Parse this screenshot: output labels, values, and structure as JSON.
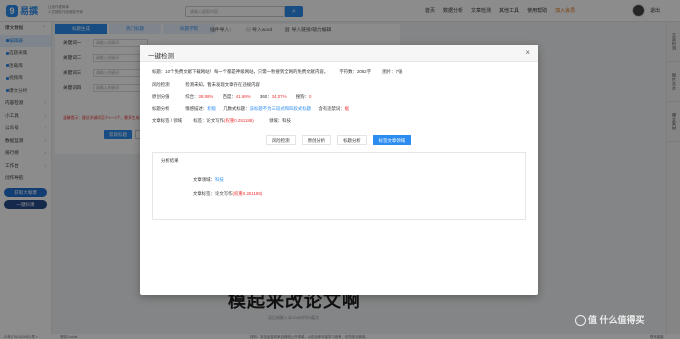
{
  "header": {
    "logo_mark": "9",
    "logo_text": "易撰",
    "slogan_line1": "让创作更简单",
    "slogan_line2": "人员团队作品赋能专家",
    "search_placeholder": "请输入搜索内容",
    "nav": [
      "首页",
      "数据分析",
      "文章检测",
      "其他工具",
      "使用帮助"
    ],
    "vip": "加入会员",
    "logout": "退出"
  },
  "sidebar": {
    "items": [
      {
        "label": "爆文数据",
        "type": "group"
      },
      {
        "label": "编辑器",
        "type": "sub",
        "active": true
      },
      {
        "label": "选题采集",
        "type": "sub"
      },
      {
        "label": "连载库",
        "type": "sub"
      },
      {
        "label": "视频库",
        "type": "sub"
      },
      {
        "label": "爆文分析",
        "type": "sub"
      },
      {
        "label": "内容检测",
        "type": "group"
      },
      {
        "label": "小工具",
        "type": "group"
      },
      {
        "label": "公众号",
        "type": "group"
      },
      {
        "label": "数据监测",
        "type": "group"
      },
      {
        "label": "排行榜",
        "type": "group"
      },
      {
        "label": "工作台",
        "type": "group"
      },
      {
        "label": "创作导航",
        "type": "group"
      }
    ],
    "btn1": "获取大咖爆",
    "btn2": "一键抖课"
  },
  "bg_form": {
    "tabs": [
      "标题生成",
      "热门标题",
      "标题学院"
    ],
    "labels": [
      "关键词一",
      "关键词二",
      "关键词三",
      "关键词四"
    ],
    "input_placeholder": "请输入关键词",
    "warning": "温馨提示：建议关键词至少1～2个，最多生成一个文章标题。请勿重复...",
    "submit": "获取标题",
    "reset": "重置",
    "toolbar": [
      "插件导入：",
      "导入word",
      "导入链接/辅力编辑"
    ]
  },
  "preview": {
    "title": "模起来改论文啊",
    "sub": "读后阅解入本1988字符5篇文"
  },
  "footer": {
    "left": "ID号(TW1400/00) 帮 ×",
    "cookie": "清除Cookie",
    "mid": "特别：本站信息均来自网络公开领域，以供全体作者学习参考，切勿非法使用。",
    "right": "联系客服"
  },
  "rail": [
    "文章检测",
    "图片去水",
    "爆文素材"
  ],
  "modal": {
    "title": "一键检测",
    "close": "×",
    "summary": "标题：10个免费文献下载网站！每一个都是神级网站，只需一秒搜到全网的免费文献内容。",
    "word_count_label": "字符数：",
    "word_count": "2082字",
    "image_label": "图片：",
    "image_count": "7张",
    "risk_key": "风险检测",
    "risk_val": "检测未知，暂未发现文章存在违规内容",
    "orig_key": "原创分值",
    "orig_items": [
      {
        "name": "综合：",
        "value": "38.88%"
      },
      {
        "name": "百度：",
        "value": "41.69%"
      },
      {
        "name": "360：",
        "value": "34.07%"
      },
      {
        "name": "搜狗：",
        "value": "0"
      }
    ],
    "title_key": "标题分析",
    "title_emotion_label": "情感描述：",
    "title_emotion_val": "积极",
    "title_kw_label": "几数式标题：",
    "title_kw_val": "该标题不为三段式和四段式标题",
    "title_sensitive_label": "含有违禁词：",
    "title_sensitive_val": "据",
    "domain_key": "文章标签 / 领域",
    "domain_tag_label": "标签：",
    "domain_tag_val": "论文写作",
    "domain_tag_weight": "(权重0.251188)",
    "domain_field_label": "领域：",
    "domain_field_val": "科技",
    "tabs": [
      "风险检测",
      "原创分析",
      "标题分析",
      "标签文章领域"
    ],
    "panel_title": "分析结果",
    "panel_field_label": "文章领域：",
    "panel_field_val": "科技",
    "panel_tag_label": "文章标签：",
    "panel_tag_val": "论文写作",
    "panel_tag_weight": "(权重0.251188)"
  },
  "watermark": "值 什么值得买",
  "colors": {
    "accent": "#2d8cf0",
    "danger": "#e33333",
    "overlay": "rgba(0,0,0,0.45)"
  }
}
